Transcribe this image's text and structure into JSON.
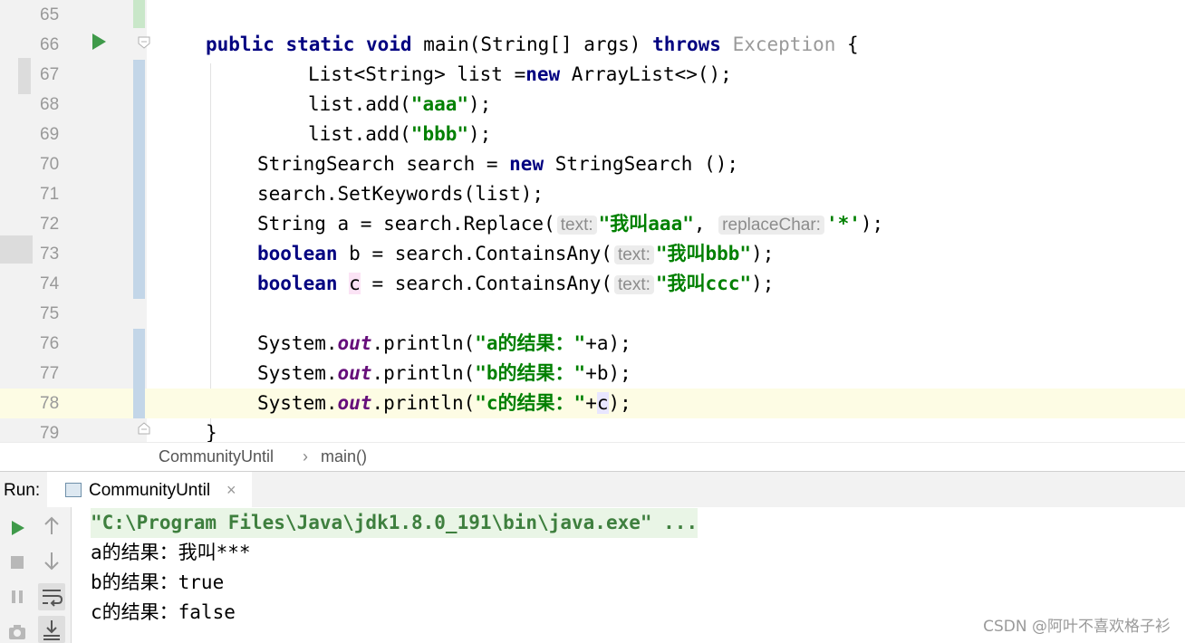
{
  "editor": {
    "lines": [
      {
        "num": "65"
      },
      {
        "num": "66"
      },
      {
        "num": "67"
      },
      {
        "num": "68"
      },
      {
        "num": "69"
      },
      {
        "num": "70"
      },
      {
        "num": "71"
      },
      {
        "num": "72"
      },
      {
        "num": "73"
      },
      {
        "num": "74"
      },
      {
        "num": "75"
      },
      {
        "num": "76"
      },
      {
        "num": "77"
      },
      {
        "num": "78"
      },
      {
        "num": "79"
      }
    ],
    "code": {
      "l66_kw": "public static void",
      "l66_rest": " main(String[] args) ",
      "l66_throws": "throws",
      "l66_exc": " Exception",
      "l66_end": " {",
      "l67_a": "List<String> list =",
      "l67_new": "new",
      "l67_b": " ArrayList<>();",
      "l68_a": "list.add(",
      "l68_str": "\"aaa\"",
      "l68_b": ");",
      "l69_a": "list.add(",
      "l69_str": "\"bbb\"",
      "l69_b": ");",
      "l70_a": "StringSearch search = ",
      "l70_new": "new",
      "l70_b": " StringSearch ();",
      "l71": "search.SetKeywords(list);",
      "l72_a": "String a = search.Replace(",
      "l72_hint1": "text:",
      "l72_str": "\"我叫aaa\"",
      "l72_comma": ",",
      "l72_hint2": "replaceChar:",
      "l72_char": "'*'",
      "l72_b": ");",
      "l73_kw": "boolean",
      "l73_a": " b = search.ContainsAny(",
      "l73_hint": "text:",
      "l73_str": "\"我叫bbb\"",
      "l73_b": ");",
      "l74_kw": "boolean",
      "l74_sp": " ",
      "l74_var": "c",
      "l74_a": " = search.ContainsAny(",
      "l74_hint": "text:",
      "l74_str": "\"我叫ccc\"",
      "l74_b": ");",
      "l76_a": "System.",
      "l76_out": "out",
      "l76_b": ".println(",
      "l76_str": "\"a的结果：\"",
      "l76_c": "+a);",
      "l77_a": "System.",
      "l77_out": "out",
      "l77_b": ".println(",
      "l77_str": "\"b的结果：\"",
      "l77_c": "+b);",
      "l78_a": "System.",
      "l78_out": "out",
      "l78_b": ".println(",
      "l78_str": "\"c的结果：\"",
      "l78_plus": "+",
      "l78_var": "c",
      "l78_c": ");",
      "l79": "}"
    }
  },
  "breadcrumb": {
    "class_name": "CommunityUntil",
    "separator": "›",
    "method": "main()"
  },
  "run_panel": {
    "label": "Run:",
    "tab_label": "CommunityUntil",
    "tab_close": "×"
  },
  "console": {
    "command": "\"C:\\Program Files\\Java\\jdk1.8.0_191\\bin\\java.exe\" ...",
    "output": [
      "a的结果：我叫***",
      "b的结果：true",
      "c的结果：false"
    ]
  },
  "watermark": "CSDN @阿叶不喜欢格子衫",
  "icons": {
    "run": "play-icon",
    "stop": "stop-icon",
    "pause": "pause-icon",
    "camera": "camera-icon",
    "up": "arrow-up-icon",
    "down": "arrow-down-icon",
    "wrap": "soft-wrap-icon",
    "scroll_end": "scroll-to-end-icon"
  },
  "colors": {
    "keyword": "#000080",
    "string": "#008000",
    "field": "#660e7a",
    "current_line": "#fdfce4",
    "change_bar": "#c3d6e8"
  }
}
